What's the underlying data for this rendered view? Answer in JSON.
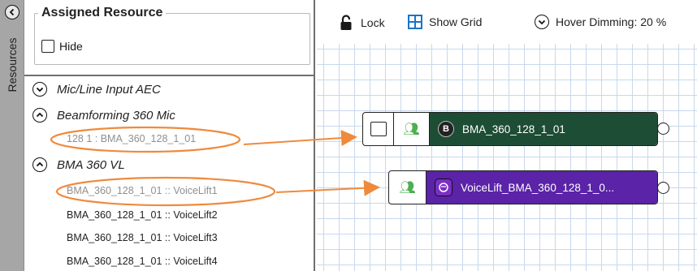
{
  "rail": {
    "label": "Resources",
    "collapse_icon": "chevron-left-icon"
  },
  "assigned_resource": {
    "title": "Assigned Resource",
    "hide_label": "Hide",
    "hide_checked": false
  },
  "tree": {
    "groups": [
      {
        "label": "Mic/Line Input AEC",
        "expanded": false,
        "icon": "chevron-down-icon"
      },
      {
        "label": "Beamforming 360 Mic",
        "expanded": true,
        "icon": "chevron-up-icon"
      },
      {
        "label": "BMA 360 VL",
        "expanded": true,
        "icon": "chevron-up-icon"
      }
    ],
    "items": [
      {
        "label": "128 1 : BMA_360_128_1_01"
      },
      {
        "label": "BMA_360_128_1_01 :: VoiceLift1"
      },
      {
        "label": "BMA_360_128_1_01 :: VoiceLift2"
      },
      {
        "label": "BMA_360_128_1_01 :: VoiceLift3"
      },
      {
        "label": "BMA_360_128_1_01 :: VoiceLift4"
      }
    ]
  },
  "toolbar": {
    "lock_label": "Lock",
    "show_grid_label": "Show Grid",
    "hover_dimming_label": "Hover Dimming: 20 %"
  },
  "canvas": {
    "blocks": [
      {
        "label": "BMA_360_128_1_01",
        "badge": "B",
        "color": "#1e4d35"
      },
      {
        "label": "VoiceLift_BMA_360_128_1_0...",
        "badge": "VL",
        "color": "#5a23a8"
      }
    ]
  },
  "colors": {
    "annotation": "#ef8a3c",
    "grid_line": "#c8d8ec",
    "beam_block": "#1e4d35",
    "voicelift_block": "#5a23a8"
  }
}
